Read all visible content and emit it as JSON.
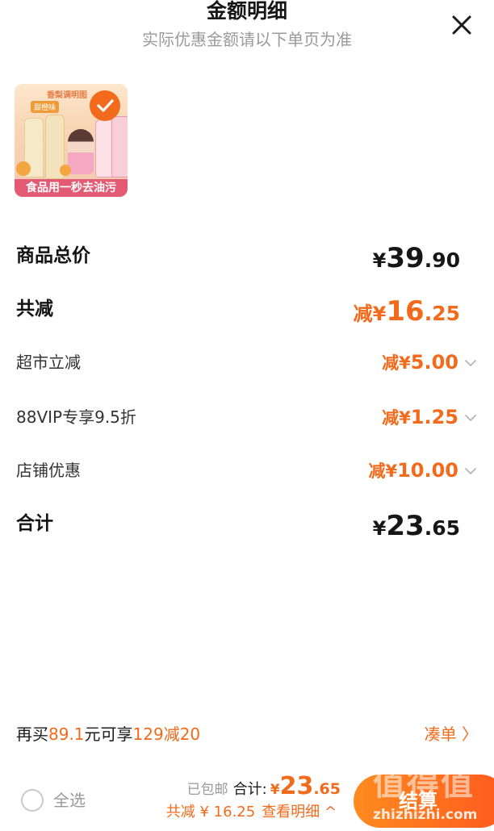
{
  "header": {
    "title": "金额明细",
    "subtitle": "实际优惠金额请以下单页为准"
  },
  "product": {
    "image_top_text": "香梨调明图",
    "image_flavor_tag": "甜橙味",
    "image_banner": "食品用一秒去油污",
    "selected": true
  },
  "rows": {
    "subtotal": {
      "label": "商品总价",
      "prefix": "¥",
      "int": "39",
      "dec": ".90"
    },
    "total_discount": {
      "label": "共减",
      "prefix": "减¥",
      "int": "16",
      "dec": ".25"
    },
    "supermarket_discount": {
      "label": "超市立减",
      "prefix": "减¥",
      "amount": "5.00"
    },
    "vip_discount": {
      "label": "88VIP专享9.5折",
      "prefix": "减¥",
      "amount": "1.25"
    },
    "store_discount": {
      "label": "店铺优惠",
      "prefix": "减¥",
      "amount": "10.00"
    },
    "total": {
      "label": "合计",
      "prefix": "¥",
      "int": "23",
      "dec": ".65"
    }
  },
  "promo": {
    "text_1": "再买",
    "amount": "89.1",
    "text_2": "元可享",
    "deal": "129减20",
    "link": "凑单 〉"
  },
  "bottom_bar": {
    "select_all": "全选",
    "shipping": "已包邮",
    "total_label": "合计:",
    "total_prefix": "¥",
    "total_int": "23",
    "total_dec": ".65",
    "discount_text": "共减 ¥ 16.25",
    "detail_link": "查看明细 ^",
    "checkout": "结算"
  },
  "watermark": {
    "mark": "值得值",
    "site": "zhizhizhi.com"
  },
  "colors": {
    "accent": "#f26a1b",
    "text": "#1b1b1b",
    "muted": "#9a9a9a"
  },
  "icons": {
    "close": "close-icon",
    "check": "check-icon",
    "chevron": "chevron-down-icon"
  }
}
